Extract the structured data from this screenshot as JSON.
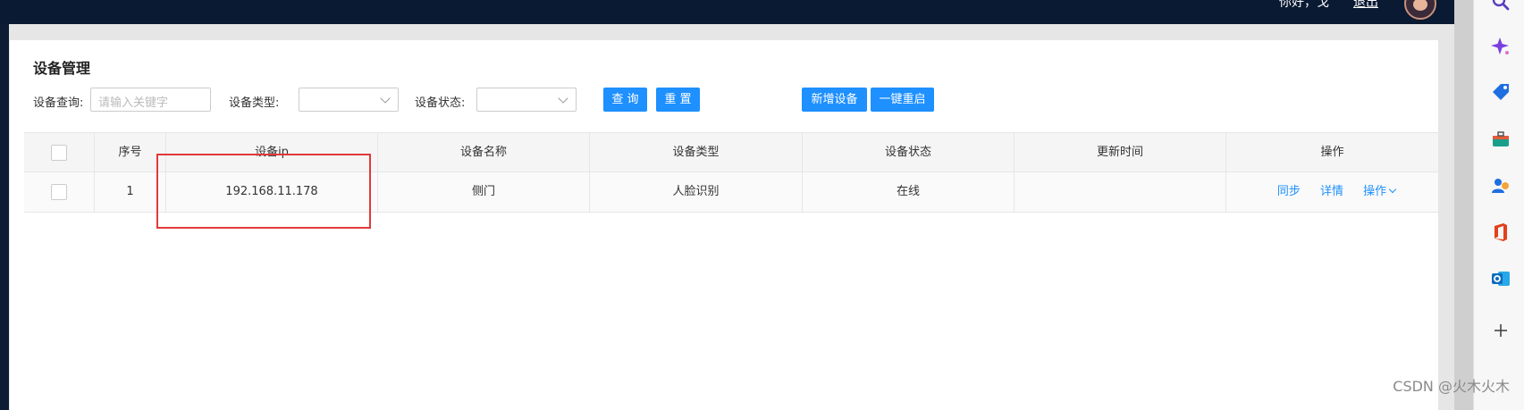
{
  "header": {
    "greeting": "你好，戈",
    "logout_label": "退出"
  },
  "page": {
    "title": "设备管理"
  },
  "filters": {
    "query_label": "设备查询:",
    "query_placeholder": "请输入关键字",
    "type_label": "设备类型:",
    "status_label": "设备状态:",
    "search_button": "查 询",
    "reset_button": "重 置",
    "add_button": "新增设备",
    "restart_button": "一键重启"
  },
  "table": {
    "columns": [
      "序号",
      "设备ip",
      "设备名称",
      "设备类型",
      "设备状态",
      "更新时间",
      "操作"
    ],
    "rows": [
      {
        "index": "1",
        "ip": "192.168.11.178",
        "name": "侧门",
        "type": "人脸识别",
        "status": "在线",
        "updated": "",
        "actions": [
          "同步",
          "详情",
          "操作"
        ]
      }
    ]
  },
  "watermark": "CSDN @火木火木",
  "sidebar_icons": [
    "search-icon",
    "sparkle-icon",
    "tag-icon",
    "toolbox-icon",
    "people-icon",
    "office-icon",
    "outlook-icon",
    "plus-icon"
  ],
  "colors": {
    "primary": "#1e90ff",
    "header_bg": "#0a1a33",
    "highlight": "#e03a3a"
  }
}
